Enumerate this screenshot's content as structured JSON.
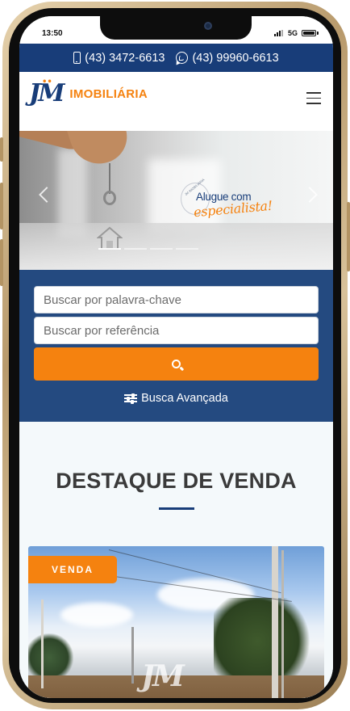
{
  "status_bar": {
    "time": "13:50",
    "network": "5G"
  },
  "contact_bar": {
    "phone": "(43) 3472-6613",
    "whatsapp": "(43) 99960-6613"
  },
  "header": {
    "logo_mark": "JM",
    "logo_text": "IMOBILIÁRIA",
    "menu_icon": "hamburger-menu-icon"
  },
  "hero": {
    "slogan_line1": "Alugue com",
    "slogan_line2": "especialista!",
    "badge_small": "JM IMOBILIÁRIA",
    "active_slide": 1,
    "slide_count": 4
  },
  "search": {
    "keyword_placeholder": "Buscar por palavra-chave",
    "reference_placeholder": "Buscar por referência",
    "button_icon": "search-icon",
    "advanced_label": "Busca Avançada"
  },
  "highlight": {
    "title": "DESTAQUE DE VENDA",
    "card": {
      "badge": "VENDA",
      "watermark": "JM"
    }
  },
  "colors": {
    "navy": "#183d79",
    "search_bg": "#244a80",
    "orange": "#f5820f",
    "title_text": "#3a3a3a"
  }
}
